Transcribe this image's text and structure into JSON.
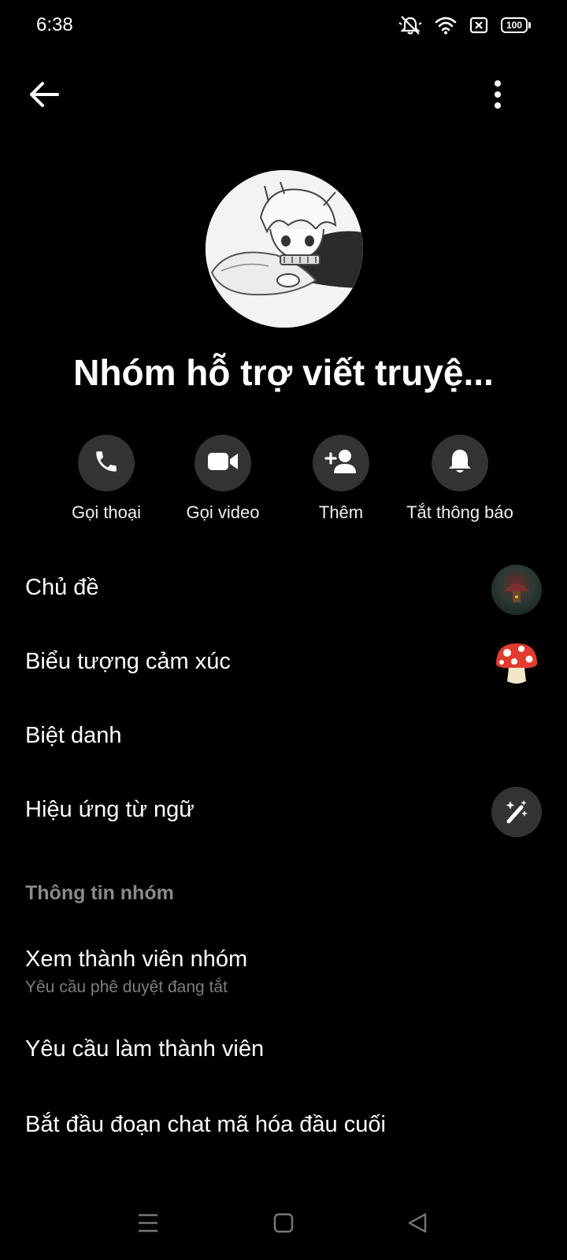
{
  "status_bar": {
    "time": "6:38",
    "battery": "100",
    "icons": [
      "mute-icon",
      "wifi-icon",
      "sim-off-icon",
      "battery-icon"
    ]
  },
  "top_bar": {
    "back_icon": "arrow-left-icon",
    "more_icon": "more-vertical-icon"
  },
  "group": {
    "name": "Nhóm hỗ trợ viết truyệ..."
  },
  "actions": [
    {
      "label": "Gọi thoại",
      "icon": "phone-icon"
    },
    {
      "label": "Gọi video",
      "icon": "video-camera-icon"
    },
    {
      "label": "Thêm",
      "icon": "add-person-icon"
    },
    {
      "label": "Tắt thông báo",
      "icon": "bell-icon"
    }
  ],
  "customize": {
    "theme_label": "Chủ đề",
    "emoji_label": "Biểu tượng cảm xúc",
    "emoji_value": "🍄",
    "nickname_label": "Biệt danh",
    "word_effects_label": "Hiệu ứng từ ngữ"
  },
  "group_info": {
    "section_title": "Thông tin nhóm",
    "members_label": "Xem thành viên nhóm",
    "members_sub": "Yêu cầu phê duyệt đang tắt",
    "requests_label": "Yêu cầu làm thành viên",
    "e2ee_label": "Bắt đầu đoạn chat mã hóa đầu cuối"
  },
  "colors": {
    "background": "#000000",
    "circle_button": "#333333",
    "section_header": "#8a8a8a",
    "sub_text": "#7d7d7d"
  },
  "nav_bar": {
    "icons": [
      "menu-icon",
      "home-square-icon",
      "back-triangle-icon"
    ]
  }
}
